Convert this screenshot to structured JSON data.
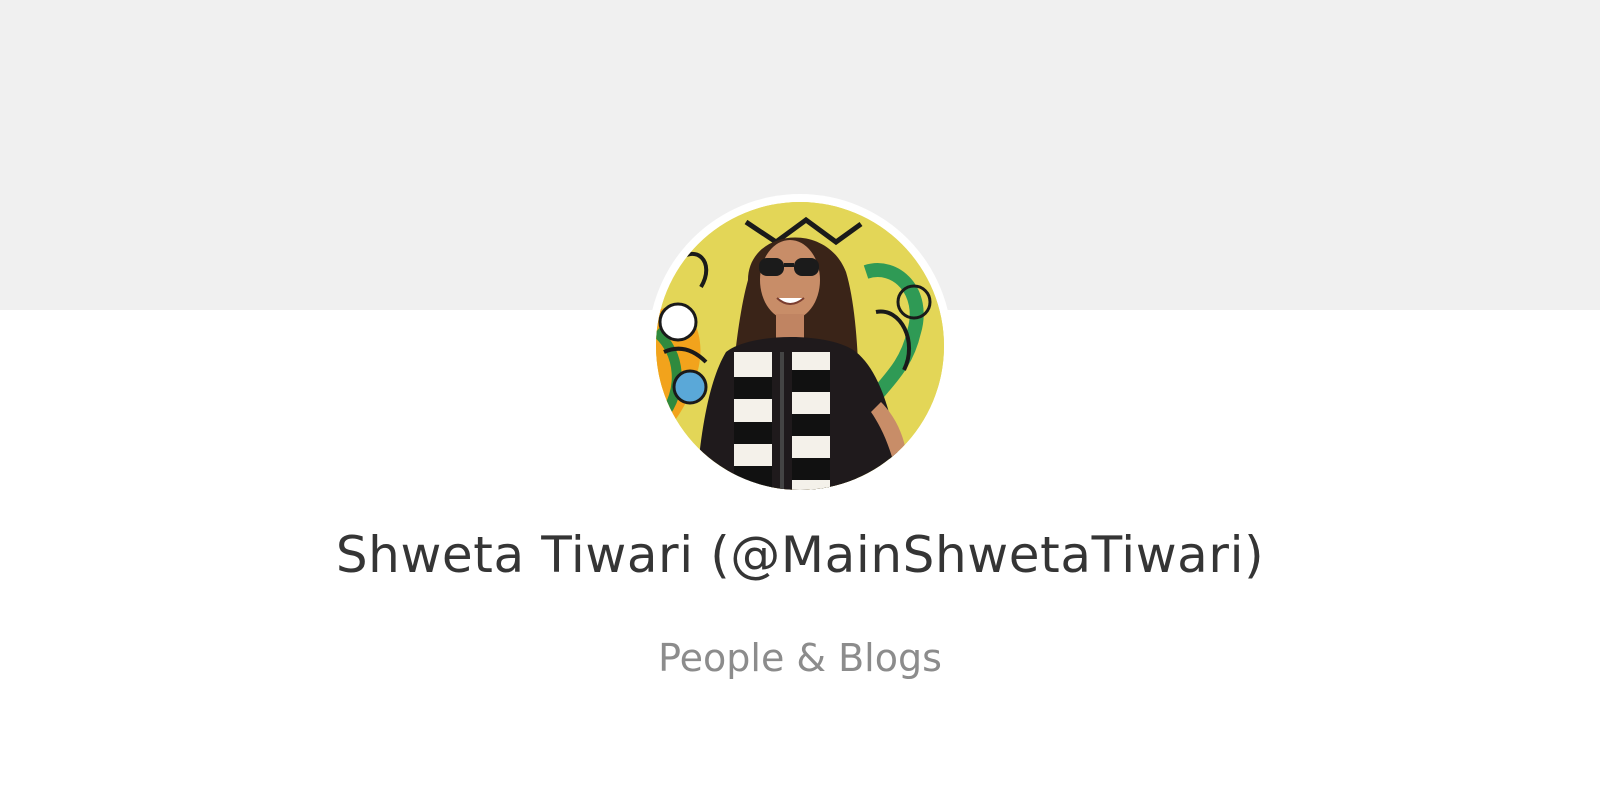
{
  "channel": {
    "name": "Shweta Tiwari (@MainShwetaTiwari)",
    "category": "People & Blogs",
    "avatar_icon": "profile-photo-avatar-icon"
  },
  "colors": {
    "cover_background": "#f0f0f0",
    "page_background": "#ffffff",
    "name_text": "#353535",
    "category_text": "#8c8c8c"
  }
}
